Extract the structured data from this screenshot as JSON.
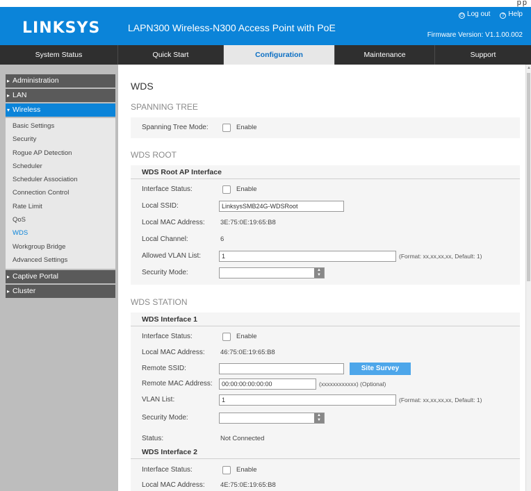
{
  "header": {
    "logo": "LINKSYS",
    "product": "LAPN300 Wireless-N300 Access Point with PoE",
    "logout": "Log out",
    "help": "Help",
    "firmware": "Firmware Version: V1.1.00.002",
    "corner_text": "pp"
  },
  "nav": {
    "tabs": [
      "System Status",
      "Quick Start",
      "Configuration",
      "Maintenance",
      "Support"
    ]
  },
  "sidebar": {
    "administration": "Administration",
    "lan": "LAN",
    "wireless": "Wireless",
    "wireless_items": [
      "Basic Settings",
      "Security",
      "Rogue AP Detection",
      "Scheduler",
      "Scheduler Association",
      "Connection Control",
      "Rate Limit",
      "QoS",
      "WDS",
      "Workgroup Bridge",
      "Advanced Settings"
    ],
    "captive_portal": "Captive Portal",
    "cluster": "Cluster"
  },
  "main": {
    "title": "WDS",
    "spanning_tree": {
      "section": "SPANNING TREE",
      "mode_label": "Spanning Tree Mode:",
      "enable": "Enable"
    },
    "wds_root": {
      "section": "WDS ROOT",
      "head": "WDS Root AP Interface",
      "interface_status_label": "Interface Status:",
      "enable": "Enable",
      "local_ssid_label": "Local SSID:",
      "local_ssid_value": "LinksysSMB24G-WDSRoot",
      "local_mac_label": "Local MAC Address:",
      "local_mac_value": "3E:75:0E:19:65:B8",
      "local_channel_label": "Local Channel:",
      "local_channel_value": "6",
      "vlan_label": "Allowed VLAN List:",
      "vlan_value": "1",
      "vlan_hint": "(Format: xx,xx,xx,xx, Default: 1)",
      "security_label": "Security Mode:"
    },
    "wds_station": {
      "section": "WDS STATION",
      "iface1": {
        "head": "WDS Interface 1",
        "interface_status_label": "Interface Status:",
        "enable": "Enable",
        "local_mac_label": "Local MAC Address:",
        "local_mac_value": "46:75:0E:19:65:B8",
        "remote_ssid_label": "Remote SSID:",
        "site_survey": "Site Survey",
        "remote_mac_label": "Remote MAC Address:",
        "remote_mac_value": "00:00:00:00:00:00",
        "remote_mac_hint": "(xxxxxxxxxxxx) (Optional)",
        "vlan_label": "VLAN List:",
        "vlan_value": "1",
        "vlan_hint": "(Format: xx,xx,xx,xx, Default: 1)",
        "security_label": "Security Mode:",
        "status_label": "Status:",
        "status_value": "Not Connected"
      },
      "iface2": {
        "head": "WDS Interface 2",
        "interface_status_label": "Interface Status:",
        "enable": "Enable",
        "local_mac_label": "Local MAC Address:",
        "local_mac_value": "4E:75:0E:19:65:B8"
      }
    }
  }
}
